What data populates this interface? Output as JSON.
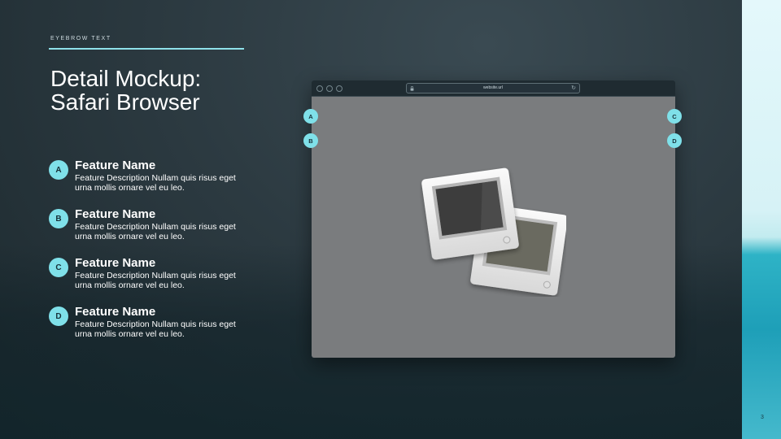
{
  "header": {
    "eyebrow": "EYEBROW TEXT",
    "title_line1": "Detail Mockup:",
    "title_line2": "Safari Browser"
  },
  "features": [
    {
      "badge": "A",
      "name": "Feature Name",
      "description": "Feature Description Nullam quis risus eget urna mollis ornare vel eu leo."
    },
    {
      "badge": "B",
      "name": "Feature Name",
      "description": "Feature Description Nullam quis risus eget urna mollis ornare vel eu leo."
    },
    {
      "badge": "C",
      "name": "Feature Name",
      "description": "Feature Description Nullam quis risus eget urna mollis ornare vel eu leo."
    },
    {
      "badge": "D",
      "name": "Feature Name",
      "description": "Feature Description Nullam quis risus eget urna mollis ornare vel eu leo."
    }
  ],
  "browser": {
    "url": "website.url",
    "icons": {
      "lock": "lock-icon",
      "reload": "reload-icon",
      "content": "photo-slides-icon"
    }
  },
  "callouts": [
    "A",
    "B",
    "C",
    "D"
  ],
  "page_number": "3",
  "colors": {
    "accent": "#7fe0e9",
    "background": "#2c3a41",
    "browser_content": "#7a7c7e",
    "strip_teal": "#1e9fb8"
  }
}
